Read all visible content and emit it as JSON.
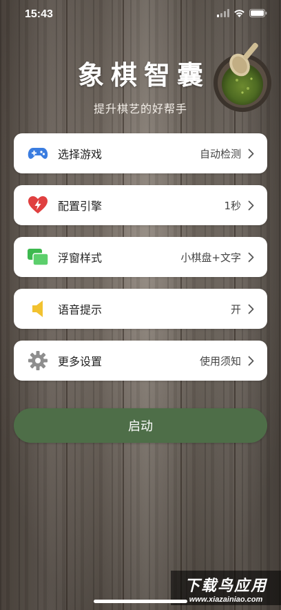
{
  "status_bar": {
    "time": "15:43"
  },
  "header": {
    "title": "象棋智囊",
    "subtitle": "提升棋艺的好帮手"
  },
  "settings": {
    "items": [
      {
        "icon": "gamepad-icon",
        "label": "选择游戏",
        "value": "自动检测",
        "icon_color": "#3b7de0"
      },
      {
        "icon": "heart-bolt-icon",
        "label": "配置引擎",
        "value": "1秒",
        "icon_color": "#e04040"
      },
      {
        "icon": "floating-window-icon",
        "label": "浮窗样式",
        "value": "小棋盘+文字",
        "icon_color": "#3db94f"
      },
      {
        "icon": "speaker-icon",
        "label": "语音提示",
        "value": "开",
        "icon_color": "#f2c230"
      },
      {
        "icon": "gear-icon",
        "label": "更多设置",
        "value": "使用须知",
        "icon_color": "#8e8e8e"
      }
    ]
  },
  "start_button": {
    "label": "启动",
    "color": "#4e6e48"
  },
  "watermark": {
    "title": "下载鸟应用",
    "url": "www.xiazainiao.com"
  }
}
